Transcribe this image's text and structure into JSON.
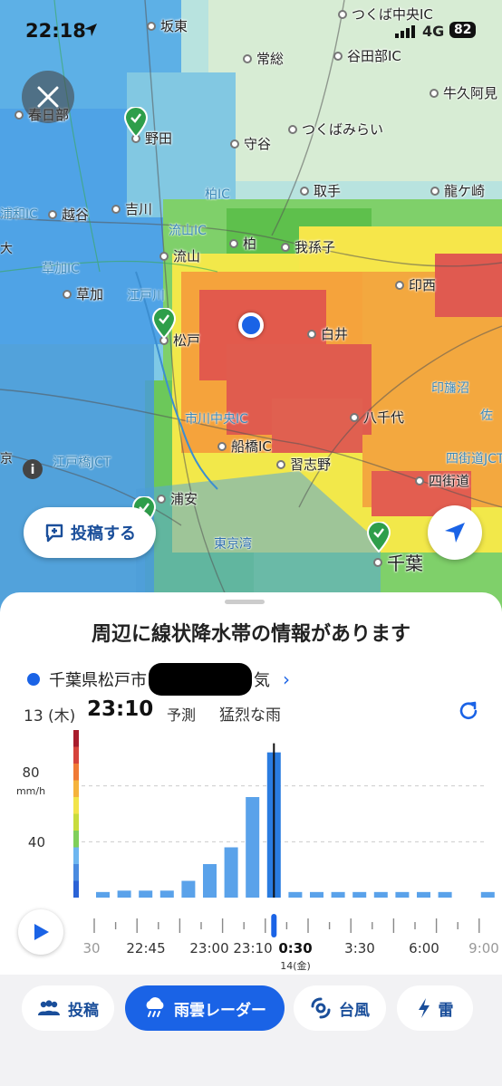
{
  "status_bar": {
    "time": "22:18",
    "network": "4G",
    "battery": "82"
  },
  "map": {
    "places": [
      {
        "id": "sakahigashi",
        "label": "坂東"
      },
      {
        "id": "joso",
        "label": "常総"
      },
      {
        "id": "tsukuba-ic",
        "label": "つくば中央IC"
      },
      {
        "id": "yawarabe-ic",
        "label": "谷田部IC"
      },
      {
        "id": "ushiku",
        "label": "牛久阿見"
      },
      {
        "id": "kasukabe",
        "label": "春日部"
      },
      {
        "id": "noda",
        "label": "野田"
      },
      {
        "id": "moriya",
        "label": "守谷"
      },
      {
        "id": "tsukubamirai",
        "label": "つくばみらい"
      },
      {
        "id": "toride",
        "label": "取手"
      },
      {
        "id": "ryugasaki",
        "label": "龍ケ崎"
      },
      {
        "id": "koshigaya",
        "label": "越谷"
      },
      {
        "id": "yoshikawa",
        "label": "吉川"
      },
      {
        "id": "nagareyama",
        "label": "流山"
      },
      {
        "id": "kashiwa",
        "label": "柏"
      },
      {
        "id": "abiko",
        "label": "我孫子"
      },
      {
        "id": "soka",
        "label": "草加"
      },
      {
        "id": "inzai",
        "label": "印西"
      },
      {
        "id": "matsudo",
        "label": "松戸"
      },
      {
        "id": "shiroi",
        "label": "白井"
      },
      {
        "id": "yachiyo",
        "label": "八千代"
      },
      {
        "id": "funabashi-ic",
        "label": "船橋IC"
      },
      {
        "id": "narashino",
        "label": "習志野"
      },
      {
        "id": "yotsukaido",
        "label": "四街道"
      },
      {
        "id": "urayasu",
        "label": "浦安"
      },
      {
        "id": "chiba",
        "label": "千葉"
      }
    ],
    "roads": [
      {
        "id": "kashiwa-ic",
        "label": "柏IC"
      },
      {
        "id": "nagareyama-ic",
        "label": "流山IC"
      },
      {
        "id": "urawa-ic",
        "label": "浦和IC"
      },
      {
        "id": "soka-ic",
        "label": "草加IC"
      },
      {
        "id": "edogawa",
        "label": "江戸川"
      },
      {
        "id": "ichikawa-ic",
        "label": "市川中央IC"
      },
      {
        "id": "inbanuma",
        "label": "印旛沼"
      },
      {
        "id": "edobashi",
        "label": "江戸橋JCT"
      },
      {
        "id": "tokyo-bay",
        "label": "東京湾"
      },
      {
        "id": "yotsukaido-jct",
        "label": "四街道JCT"
      },
      {
        "id": "sa",
        "label": "佐"
      },
      {
        "id": "kyo",
        "label": "京"
      },
      {
        "id": "ta",
        "label": "大"
      }
    ],
    "post_button": "投稿する"
  },
  "sheet": {
    "headline": "周辺に線状降水帯の情報があります",
    "location_prefix": "千葉県松戸市",
    "location_suffix": "気",
    "date": "13 (木)",
    "time": "23:10",
    "forecast_label": "予測",
    "description": "猛烈な雨",
    "unit": "mm/h",
    "y_labels": [
      "80",
      "40"
    ],
    "tick_labels": [
      "30",
      "22:45",
      "23:00",
      "23:10",
      "0:30",
      "3:30",
      "6:00",
      "9:00"
    ],
    "tick_sublabel": "14(金)"
  },
  "chart_data": {
    "type": "bar",
    "ylabel": "mm/h",
    "ylim": [
      0,
      120
    ],
    "y_ticks": [
      40,
      80
    ],
    "selected_index": 8,
    "values": [
      4,
      5,
      5,
      5,
      12,
      24,
      36,
      72,
      104,
      4,
      4,
      4,
      4,
      4,
      4,
      4,
      4,
      0,
      4,
      4,
      4
    ]
  },
  "tabs": [
    {
      "id": "post",
      "label": "投稿",
      "icon": "people-icon",
      "active": false
    },
    {
      "id": "radar",
      "label": "雨雲レーダー",
      "icon": "rain-cloud-icon",
      "active": true
    },
    {
      "id": "typhoon",
      "label": "台風",
      "icon": "typhoon-icon",
      "active": false
    },
    {
      "id": "thunder",
      "label": "雷",
      "icon": "lightning-icon",
      "active": false
    }
  ],
  "colors": {
    "accent": "#1a63e6",
    "bar": "#5aa2ea",
    "selected_bar": "#2a7ce0"
  }
}
